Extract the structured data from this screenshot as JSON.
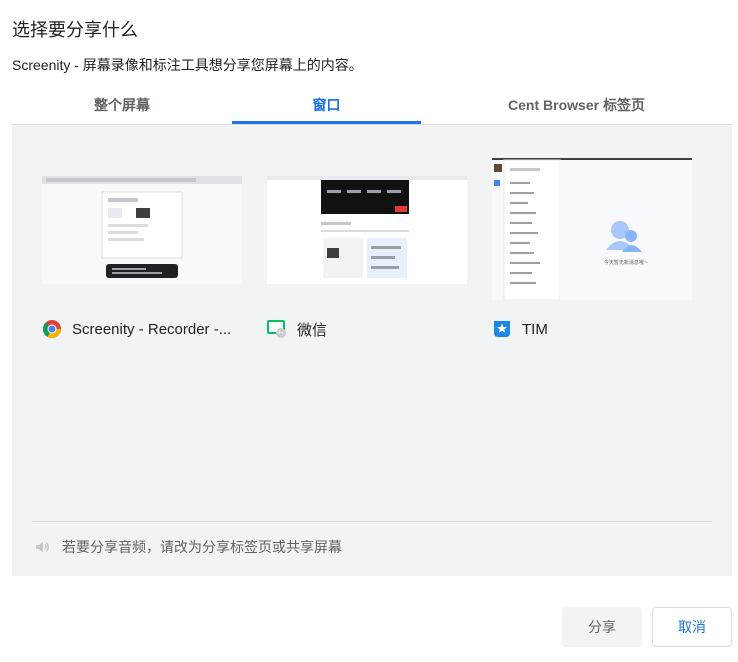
{
  "dialog": {
    "title": "选择要分享什么",
    "subtitle": "Screenity - 屏幕录像和标注工具想分享您屏幕上的内容。"
  },
  "tabs": [
    {
      "label": "整个屏幕",
      "active": false
    },
    {
      "label": "窗口",
      "active": true
    },
    {
      "label": "Cent Browser 标签页",
      "active": false
    }
  ],
  "windows": [
    {
      "label": "Screenity - Recorder -...",
      "icon": "chrome-icon"
    },
    {
      "label": "微信",
      "icon": "wechat-icon"
    },
    {
      "label": "TIM",
      "icon": "tim-icon"
    }
  ],
  "thumb_text": {
    "tim_empty_state": "今天暂无新消息哦~"
  },
  "audio_note": "若要分享音频，请改为分享标签页或共享屏幕",
  "buttons": {
    "share": "分享",
    "cancel": "取消"
  },
  "colors": {
    "accent": "#1a73e8",
    "panel_bg": "#f1f3f4"
  }
}
